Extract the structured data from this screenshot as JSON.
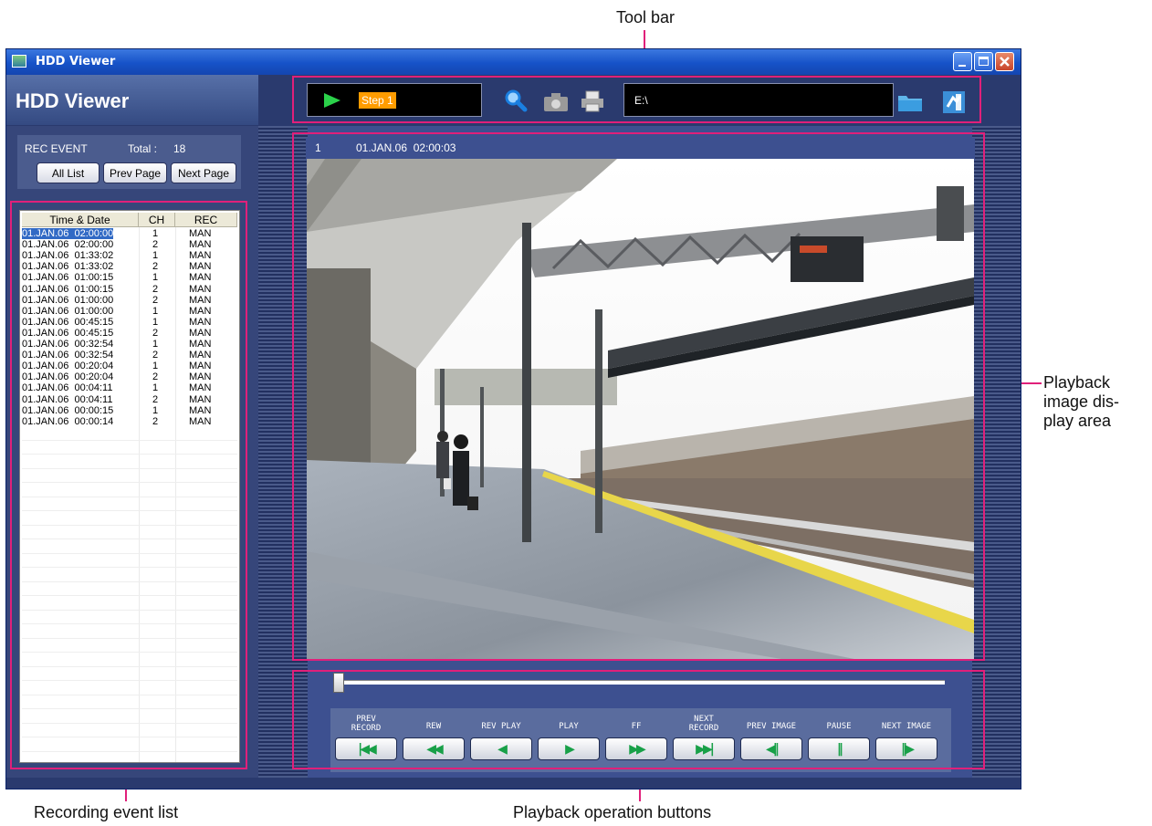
{
  "annotations": {
    "toolbar": "Tool bar",
    "playback_area": "Playback\nimage dis-\nplay area",
    "playback_area_lines": [
      "Playback",
      "image dis-",
      "play area"
    ],
    "event_list": "Recording event list",
    "operation_buttons": "Playback operation buttons"
  },
  "window": {
    "title": "HDD Viewer",
    "app_name": "HDD Viewer"
  },
  "toolbar": {
    "step_label": "Step 1",
    "path": "E:\\",
    "icons": [
      "play-icon",
      "search-icon",
      "camera-icon",
      "print-icon",
      "folder-icon",
      "settings-icon"
    ]
  },
  "event_panel": {
    "title": "REC EVENT",
    "total_label": "Total :",
    "total_value": "18",
    "buttons": [
      "All List",
      "Prev Page",
      "Next Page"
    ]
  },
  "event_list": {
    "columns": [
      "Time & Date",
      "CH",
      "REC"
    ],
    "rows": [
      [
        "01.JAN.06  02:00:00",
        "1",
        "MAN"
      ],
      [
        "01.JAN.06  02:00:00",
        "2",
        "MAN"
      ],
      [
        "01.JAN.06  01:33:02",
        "1",
        "MAN"
      ],
      [
        "01.JAN.06  01:33:02",
        "2",
        "MAN"
      ],
      [
        "01.JAN.06  01:00:15",
        "1",
        "MAN"
      ],
      [
        "01.JAN.06  01:00:15",
        "2",
        "MAN"
      ],
      [
        "01.JAN.06  01:00:00",
        "2",
        "MAN"
      ],
      [
        "01.JAN.06  01:00:00",
        "1",
        "MAN"
      ],
      [
        "01.JAN.06  00:45:15",
        "1",
        "MAN"
      ],
      [
        "01.JAN.06  00:45:15",
        "2",
        "MAN"
      ],
      [
        "01.JAN.06  00:32:54",
        "1",
        "MAN"
      ],
      [
        "01.JAN.06  00:32:54",
        "2",
        "MAN"
      ],
      [
        "01.JAN.06  00:20:04",
        "1",
        "MAN"
      ],
      [
        "01.JAN.06  00:20:04",
        "2",
        "MAN"
      ],
      [
        "01.JAN.06  00:04:11",
        "1",
        "MAN"
      ],
      [
        "01.JAN.06  00:04:11",
        "2",
        "MAN"
      ],
      [
        "01.JAN.06  00:00:15",
        "1",
        "MAN"
      ],
      [
        "01.JAN.06  00:00:14",
        "2",
        "MAN"
      ]
    ],
    "selected_index": 0
  },
  "playback": {
    "channel": "1",
    "timestamp": "01.JAN.06  02:00:03",
    "slider_position": 0
  },
  "controls": [
    {
      "label": "PREV\nRECORD",
      "icon": "prev-record-icon",
      "glyph": "|◀◀"
    },
    {
      "label": "REW",
      "icon": "rewind-icon",
      "glyph": "◀◀"
    },
    {
      "label": "REV PLAY",
      "icon": "reverse-play-icon",
      "glyph": "◀"
    },
    {
      "label": "PLAY",
      "icon": "play-icon",
      "glyph": "▶"
    },
    {
      "label": "FF",
      "icon": "fast-forward-icon",
      "glyph": "▶▶"
    },
    {
      "label": "NEXT\nRECORD",
      "icon": "next-record-icon",
      "glyph": "▶▶|"
    },
    {
      "label": "PREV IMAGE",
      "icon": "prev-image-icon",
      "glyph": "◀||"
    },
    {
      "label": "PAUSE",
      "icon": "pause-icon",
      "glyph": "||"
    },
    {
      "label": "NEXT IMAGE",
      "icon": "next-image-icon",
      "glyph": "||▶"
    }
  ],
  "colors": {
    "annotation": "#e0207a",
    "window_bg": "#2a3a6e",
    "button_icon": "#18a048",
    "step_highlight": "#ff9c00"
  }
}
